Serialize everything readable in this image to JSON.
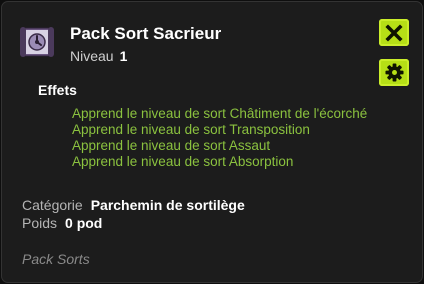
{
  "item": {
    "icon": "spell-scroll-icon",
    "name": "Pack Sort Sacrieur",
    "level_label": "Niveau",
    "level_value": "1"
  },
  "buttons": {
    "close_icon": "close-icon",
    "settings_icon": "gear-icon"
  },
  "effects": {
    "title": "Effets",
    "items": [
      "Apprend le niveau de sort Châtiment de l'écorché",
      "Apprend le niveau de sort Transposition",
      "Apprend le niveau de sort Assaut",
      "Apprend le niveau de sort Absorption"
    ]
  },
  "properties": {
    "category_label": "Catégorie",
    "category_value": "Parchemin de sortilège",
    "weight_label": "Poids",
    "weight_value": "0 pod"
  },
  "set_name": "Pack Sorts",
  "colors": {
    "accent": "#b6df16",
    "effect_text": "#8bc23f",
    "background": "#1c1c1c"
  }
}
